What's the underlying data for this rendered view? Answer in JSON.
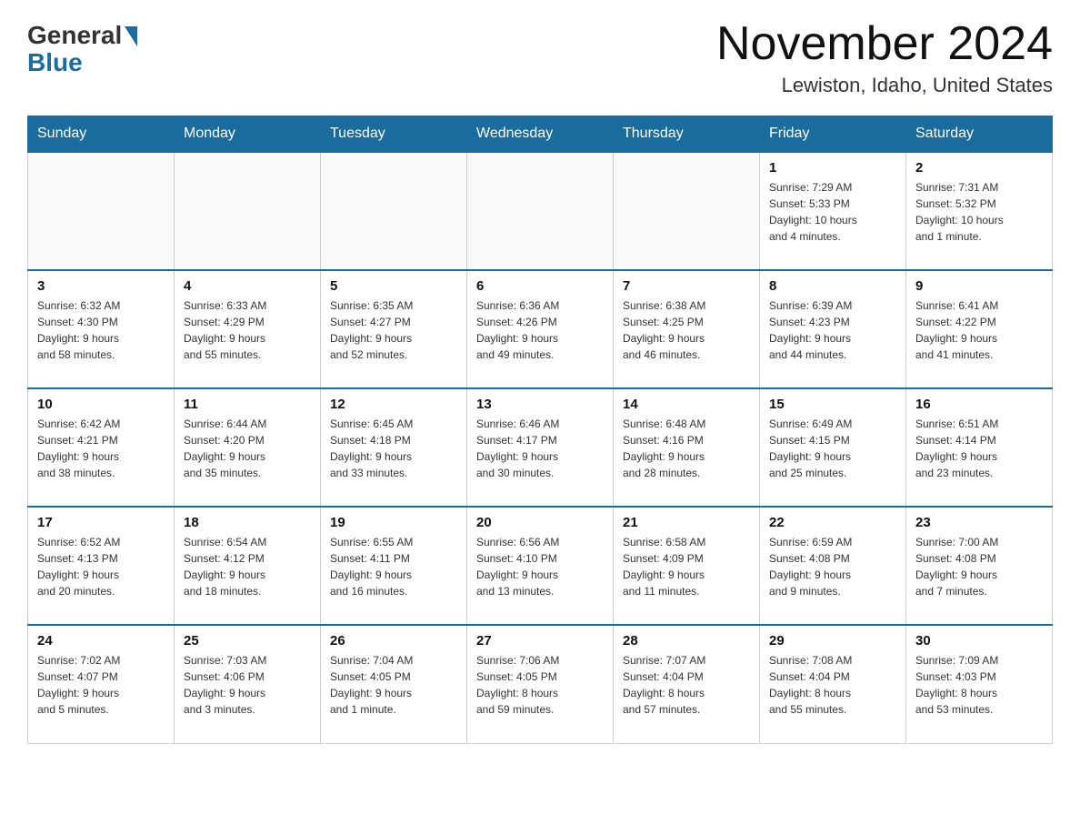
{
  "header": {
    "logo_text": "General",
    "logo_blue": "Blue",
    "title": "November 2024",
    "subtitle": "Lewiston, Idaho, United States"
  },
  "days_of_week": [
    "Sunday",
    "Monday",
    "Tuesday",
    "Wednesday",
    "Thursday",
    "Friday",
    "Saturday"
  ],
  "weeks": [
    [
      {
        "day": "",
        "info": ""
      },
      {
        "day": "",
        "info": ""
      },
      {
        "day": "",
        "info": ""
      },
      {
        "day": "",
        "info": ""
      },
      {
        "day": "",
        "info": ""
      },
      {
        "day": "1",
        "info": "Sunrise: 7:29 AM\nSunset: 5:33 PM\nDaylight: 10 hours\nand 4 minutes."
      },
      {
        "day": "2",
        "info": "Sunrise: 7:31 AM\nSunset: 5:32 PM\nDaylight: 10 hours\nand 1 minute."
      }
    ],
    [
      {
        "day": "3",
        "info": "Sunrise: 6:32 AM\nSunset: 4:30 PM\nDaylight: 9 hours\nand 58 minutes."
      },
      {
        "day": "4",
        "info": "Sunrise: 6:33 AM\nSunset: 4:29 PM\nDaylight: 9 hours\nand 55 minutes."
      },
      {
        "day": "5",
        "info": "Sunrise: 6:35 AM\nSunset: 4:27 PM\nDaylight: 9 hours\nand 52 minutes."
      },
      {
        "day": "6",
        "info": "Sunrise: 6:36 AM\nSunset: 4:26 PM\nDaylight: 9 hours\nand 49 minutes."
      },
      {
        "day": "7",
        "info": "Sunrise: 6:38 AM\nSunset: 4:25 PM\nDaylight: 9 hours\nand 46 minutes."
      },
      {
        "day": "8",
        "info": "Sunrise: 6:39 AM\nSunset: 4:23 PM\nDaylight: 9 hours\nand 44 minutes."
      },
      {
        "day": "9",
        "info": "Sunrise: 6:41 AM\nSunset: 4:22 PM\nDaylight: 9 hours\nand 41 minutes."
      }
    ],
    [
      {
        "day": "10",
        "info": "Sunrise: 6:42 AM\nSunset: 4:21 PM\nDaylight: 9 hours\nand 38 minutes."
      },
      {
        "day": "11",
        "info": "Sunrise: 6:44 AM\nSunset: 4:20 PM\nDaylight: 9 hours\nand 35 minutes."
      },
      {
        "day": "12",
        "info": "Sunrise: 6:45 AM\nSunset: 4:18 PM\nDaylight: 9 hours\nand 33 minutes."
      },
      {
        "day": "13",
        "info": "Sunrise: 6:46 AM\nSunset: 4:17 PM\nDaylight: 9 hours\nand 30 minutes."
      },
      {
        "day": "14",
        "info": "Sunrise: 6:48 AM\nSunset: 4:16 PM\nDaylight: 9 hours\nand 28 minutes."
      },
      {
        "day": "15",
        "info": "Sunrise: 6:49 AM\nSunset: 4:15 PM\nDaylight: 9 hours\nand 25 minutes."
      },
      {
        "day": "16",
        "info": "Sunrise: 6:51 AM\nSunset: 4:14 PM\nDaylight: 9 hours\nand 23 minutes."
      }
    ],
    [
      {
        "day": "17",
        "info": "Sunrise: 6:52 AM\nSunset: 4:13 PM\nDaylight: 9 hours\nand 20 minutes."
      },
      {
        "day": "18",
        "info": "Sunrise: 6:54 AM\nSunset: 4:12 PM\nDaylight: 9 hours\nand 18 minutes."
      },
      {
        "day": "19",
        "info": "Sunrise: 6:55 AM\nSunset: 4:11 PM\nDaylight: 9 hours\nand 16 minutes."
      },
      {
        "day": "20",
        "info": "Sunrise: 6:56 AM\nSunset: 4:10 PM\nDaylight: 9 hours\nand 13 minutes."
      },
      {
        "day": "21",
        "info": "Sunrise: 6:58 AM\nSunset: 4:09 PM\nDaylight: 9 hours\nand 11 minutes."
      },
      {
        "day": "22",
        "info": "Sunrise: 6:59 AM\nSunset: 4:08 PM\nDaylight: 9 hours\nand 9 minutes."
      },
      {
        "day": "23",
        "info": "Sunrise: 7:00 AM\nSunset: 4:08 PM\nDaylight: 9 hours\nand 7 minutes."
      }
    ],
    [
      {
        "day": "24",
        "info": "Sunrise: 7:02 AM\nSunset: 4:07 PM\nDaylight: 9 hours\nand 5 minutes."
      },
      {
        "day": "25",
        "info": "Sunrise: 7:03 AM\nSunset: 4:06 PM\nDaylight: 9 hours\nand 3 minutes."
      },
      {
        "day": "26",
        "info": "Sunrise: 7:04 AM\nSunset: 4:05 PM\nDaylight: 9 hours\nand 1 minute."
      },
      {
        "day": "27",
        "info": "Sunrise: 7:06 AM\nSunset: 4:05 PM\nDaylight: 8 hours\nand 59 minutes."
      },
      {
        "day": "28",
        "info": "Sunrise: 7:07 AM\nSunset: 4:04 PM\nDaylight: 8 hours\nand 57 minutes."
      },
      {
        "day": "29",
        "info": "Sunrise: 7:08 AM\nSunset: 4:04 PM\nDaylight: 8 hours\nand 55 minutes."
      },
      {
        "day": "30",
        "info": "Sunrise: 7:09 AM\nSunset: 4:03 PM\nDaylight: 8 hours\nand 53 minutes."
      }
    ]
  ]
}
